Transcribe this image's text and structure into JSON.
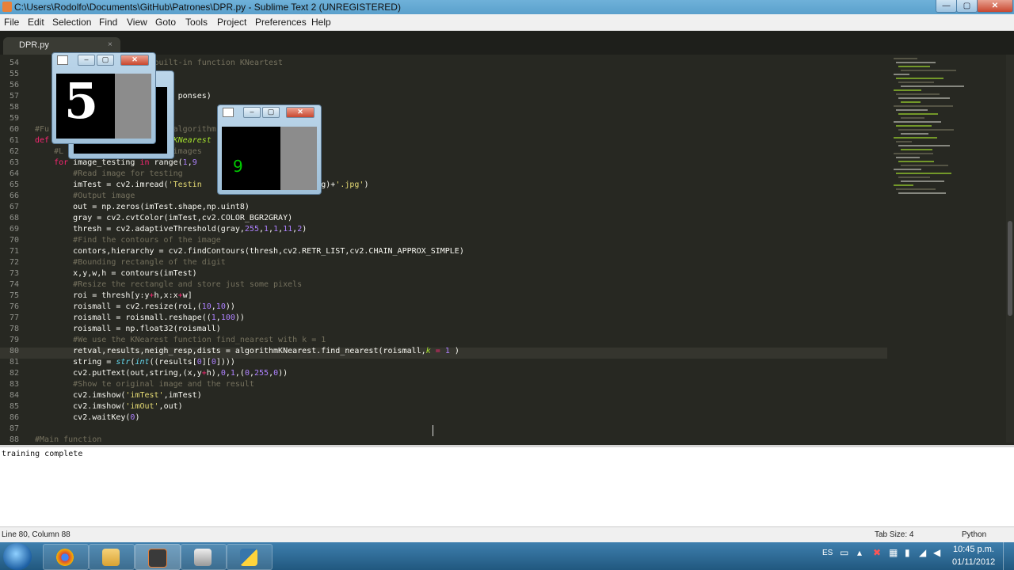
{
  "window": {
    "title": "C:\\Users\\Rodolfo\\Documents\\GitHub\\Patrones\\DPR.py - Sublime Text 2 (UNREGISTERED)"
  },
  "menu": [
    "File",
    "Edit",
    "Selection",
    "Find",
    "View",
    "Goto",
    "Tools",
    "Project",
    "Preferences",
    "Help"
  ],
  "tab": {
    "label": "DPR.py",
    "close": "×"
  },
  "editor": {
    "line_numbers": [
      "54",
      "55",
      "56",
      "57",
      "58",
      "59",
      "60",
      "61",
      "62",
      "63",
      "64",
      "65",
      "66",
      "67",
      "68",
      "69",
      "70",
      "71",
      "72",
      "73",
      "74",
      "75",
      "76",
      "77",
      "78",
      "79",
      "80",
      "81",
      "82",
      "83",
      "84",
      "85",
      "86",
      "87",
      "88"
    ]
  },
  "console": {
    "output": "training complete"
  },
  "status": {
    "position": "Line 80, Column 88",
    "tab_size": "Tab Size: 4",
    "syntax": "Python"
  },
  "tray": {
    "lang": "ES",
    "time": "10:45 p.m.",
    "date": "01/11/2012"
  },
  "imgwin1": {
    "digit": "5"
  },
  "imgwin2": {
    "digit": "9",
    "digit_color": "#00c800"
  },
  "colors": {
    "editor_bg": "#272822",
    "accent": "#66d9ef",
    "taskbar": "#2a6a99"
  }
}
